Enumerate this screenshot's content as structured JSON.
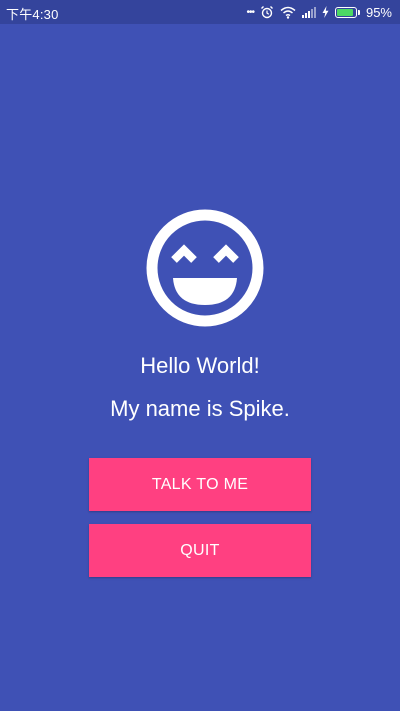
{
  "status_bar": {
    "time": "下午4:30",
    "dots": "•••",
    "battery_level": 0.95,
    "battery_percent": "95%",
    "icons": [
      "more-icon",
      "alarm-icon",
      "wifi-icon",
      "signal-icon",
      "charging-icon",
      "battery-icon"
    ]
  },
  "main": {
    "icon": "smiley-face-icon",
    "greeting": "Hello World!",
    "name_line": "My name is Spike.",
    "talk_button_label": "TALK TO ME",
    "quit_button_label": "QUIT"
  },
  "colors": {
    "background": "#3F51B5",
    "status_bar": "#34449c",
    "accent": "#FF4081",
    "text": "#FFFFFF",
    "battery_fill": "#4CD964"
  }
}
